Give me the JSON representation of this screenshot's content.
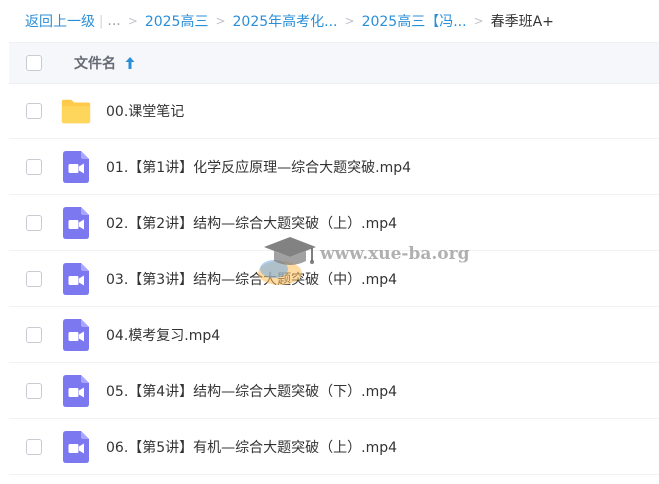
{
  "breadcrumb": {
    "back_label": "返回上一级",
    "pipe": "|",
    "ellipsis": "...",
    "separator": ">",
    "crumbs": [
      "2025高三",
      "2025年高考化...",
      "2025高三【冯..."
    ],
    "current": "春季班A+"
  },
  "list_header": {
    "column_name": "文件名"
  },
  "files": [
    {
      "name": "00.课堂笔记",
      "type": "folder"
    },
    {
      "name": "01.【第1讲】化学反应原理—综合大题突破.mp4",
      "type": "video"
    },
    {
      "name": "02.【第2讲】结构—综合大题突破（上）.mp4",
      "type": "video"
    },
    {
      "name": "03.【第3讲】结构—综合大题突破（中）.mp4",
      "type": "video"
    },
    {
      "name": "04.模考复习.mp4",
      "type": "video"
    },
    {
      "name": "05.【第4讲】结构—综合大题突破（下）.mp4",
      "type": "video"
    },
    {
      "name": "06.【第5讲】有机—综合大题突破（上）.mp4",
      "type": "video"
    }
  ],
  "watermark": {
    "text": "www.xue-ba.org"
  },
  "colors": {
    "link": "#2b8fd8",
    "folder": "#ffd65c",
    "video": "#7b78f0",
    "header_bg": "#f5f7fa"
  },
  "icons": {
    "folder": "folder-icon",
    "video": "video-file-icon",
    "sort": "sort-ascending-icon",
    "watermark_logo": "graduation-cap-icon"
  }
}
